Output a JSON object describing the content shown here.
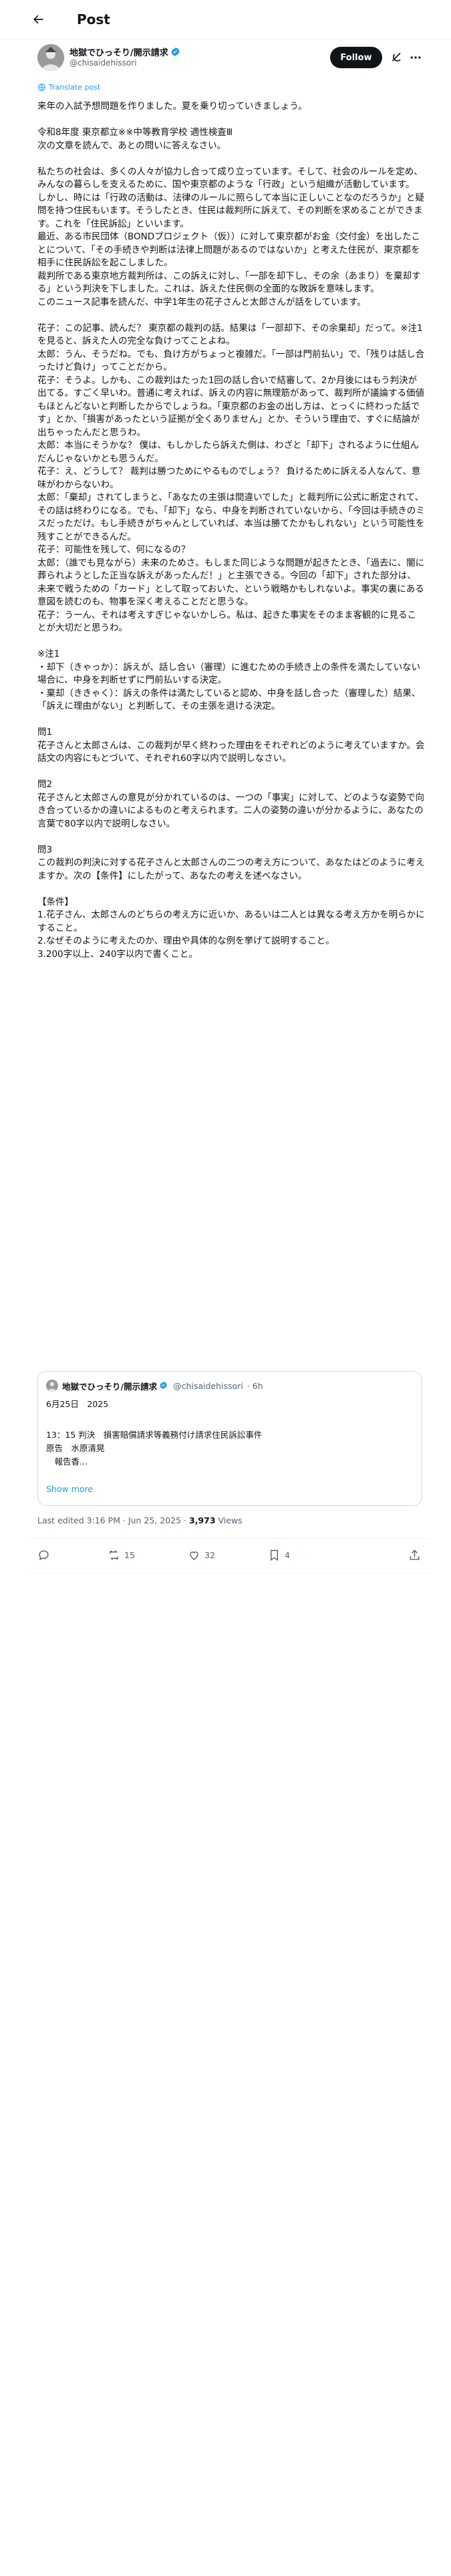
{
  "header": {
    "title": "Post"
  },
  "author": {
    "name": "地獄でひっそり/開示請求",
    "handle": "@chisaidehissori",
    "follow_label": "Follow"
  },
  "translate": {
    "label": "Translate post"
  },
  "post": {
    "paragraphs": [
      "来年の入試予想問題を作りました。夏を乗り切っていきましょう。",
      "",
      "令和8年度 東京都立※※中等教育学校 適性検査Ⅲ",
      "次の文章を読んで、あとの問いに答えなさい。",
      "",
      "私たちの社会は、多くの人々が協力し合って成り立っています。そして、社会のルールを定め、みんなの暮らしを支えるために、国や東京都のような「行政」という組織が活動しています。",
      "しかし、時には「行政の活動は、法律のルールに照らして本当に正しいことなのだろうか」と疑問を持つ住民もいます。そうしたとき、住民は裁判所に訴えて、その判断を求めることができます。これを「住民訴訟」といいます。",
      "最近、ある市民団体（BONDプロジェクト（仮））に対して東京都がお金（交付金）を出したことについて、「その手続きや判断は法律上問題があるのではないか」と考えた住民が、東京都を相手に住民訴訟を起こしました。",
      "裁判所である東京地方裁判所は、この訴えに対し、「一部を却下し、その余（あまり）を棄却する」という判決を下しました。これは、訴えた住民側の全面的な敗訴を意味します。",
      "このニュース記事を読んだ、中学1年生の花子さんと太郎さんが話をしています。",
      "",
      "花子：この記事、読んだ？ 東京都の裁判の話。結果は「一部却下、その余棄却」だって。※注1を見ると、訴えた人の完全な負けってことよね。",
      "太郎：うん、そうだね。でも、負け方がちょっと複雑だ。「一部は門前払い」で、「残りは話し合ったけど負け」ってことだから。",
      "花子：そうよ。しかも、この裁判はたった1回の話し合いで結審して、2か月後にはもう判決が出てる。すごく早いわ。普通に考えれば、訴えの内容に無理筋があって、裁判所が議論する価値もほとんどないと判断したからでしょうね。「東京都のお金の出し方は、とっくに終わった話です」とか、「損害があったという証拠が全くありません」とか、そういう理由で、すぐに結論が出ちゃったんだと思うわ。",
      "太郎：本当にそうかな？ 僕は、もしかしたら訴えた側は、わざと「却下」されるように仕組んだんじゃないかとも思うんだ。",
      "花子：え、どうして？ 裁判は勝つためにやるものでしょう？ 負けるために訴える人なんて、意味がわからないわ。",
      "太郎：「棄却」されてしまうと、「あなたの主張は間違いでした」と裁判所に公式に断定されて、その話は終わりになる。でも、「却下」なら、中身を判断されていないから、「今回は手続きのミスだっただけ。もし手続きがちゃんとしていれば、本当は勝てたかもしれない」という可能性を残すことができるんだ。",
      "花子：可能性を残して、何になるの？",
      "太郎：（誰でも見ながら）未来のためさ。もしまた同じような問題が起きたとき、「過去に、闇に葬られようとした正当な訴えがあったんだ！」と主張できる。今回の「却下」された部分は、未来で戦うための「カード」として取っておいた、という戦略かもしれないよ。事実の裏にある意図を読むのも、物事を深く考えることだと思うな。",
      "花子：うーん、それは考えすぎじゃないかしら。私は、起きた事実をそのまま客観的に見ることが大切だと思うわ。",
      "",
      "※注1",
      "・却下（きゃっか）：訴えが、話し合い（審理）に進むための手続き上の条件を満たしていない場合に、中身を判断せずに門前払いする決定。",
      "・棄却（ききゃく）：訴えの条件は満たしていると認め、中身を話し合った（審理した）結果、「訴えに理由がない」と判断して、その主張を退ける決定。",
      "",
      "問1",
      "花子さんと太郎さんは、この裁判が早く終わった理由をそれぞれどのように考えていますか。会話文の内容にもとづいて、それぞれ60字以内で説明しなさい。",
      "",
      "問2",
      "花子さんと太郎さんの意見が分かれているのは、一つの「事実」に対して、どのような姿勢で向き合っているかの違いによるものと考えられます。二人の姿勢の違いが分かるように、あなたの言葉で80字以内で説明しなさい。",
      "",
      "問3",
      "この裁判の判決に対する花子さんと太郎さんの二つの考え方について、あなたはどのように考えますか。次の【条件】にしたがって、あなたの考えを述べなさい。",
      "",
      "【条件】",
      "1.花子さん、太郎さんのどちらの考え方に近いか、あるいは二人とは異なる考え方かを明らかにすること。",
      "2.なぜそのように考えたのか、理由や具体的な例を挙げて説明すること。",
      "3.200字以上、240字以内で書くこと。"
    ]
  },
  "quote": {
    "name": "地獄でひっそり/開示請求",
    "handle": "@chisaidehissori",
    "time": "· 6h",
    "line1": "6月25日　2025",
    "line2": "13：15 判決　損害賠償請求等義務付け請求住民訴訟事件",
    "line3": "原告　水原清晃",
    "line4": "　報告香...",
    "show_more": "Show more"
  },
  "meta": {
    "edited": "Last edited 3:16 PM · Jun 25, 2025 · ",
    "views_count": "3,973",
    "views_label": " Views"
  },
  "actions": {
    "reply_count": "",
    "repost_count": "15",
    "like_count": "32",
    "bookmark_count": "4"
  },
  "colors": {
    "accent": "#1d9bf0",
    "text": "#0f1419",
    "muted": "#536471",
    "verified": "#1d9bf0"
  }
}
